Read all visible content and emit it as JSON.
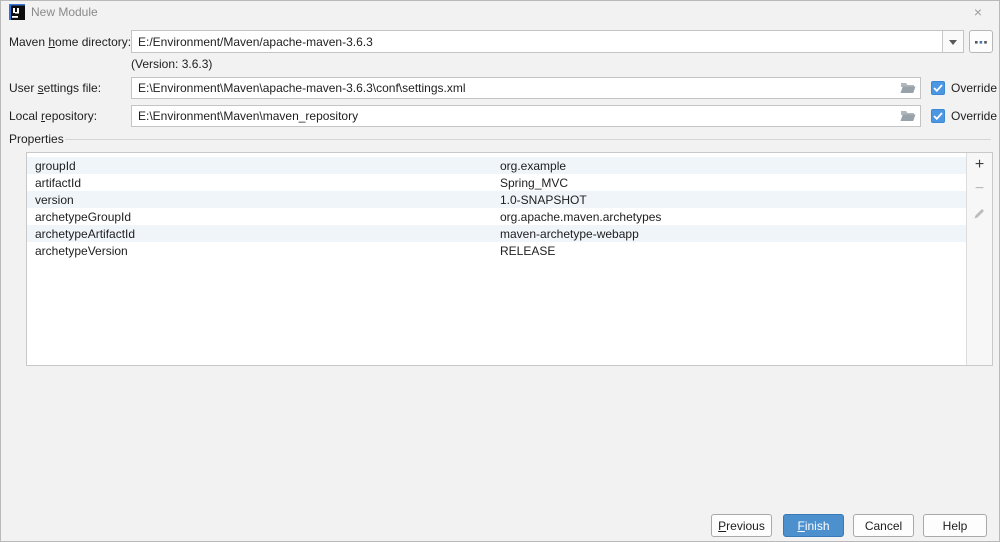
{
  "window": {
    "title": "New Module",
    "close_icon": "×"
  },
  "form": {
    "maven_home": {
      "label_pre": "Maven ",
      "label_mnemonic": "h",
      "label_post": "ome directory:",
      "value": "E:/Environment/Maven/apache-maven-3.6.3",
      "version_note": "(Version: 3.6.3)"
    },
    "user_settings": {
      "label_pre": "User ",
      "label_mnemonic": "s",
      "label_post": "ettings file:",
      "value": "E:\\Environment\\Maven\\apache-maven-3.6.3\\conf\\settings.xml",
      "override_label": "Override",
      "override_checked": true
    },
    "local_repository": {
      "label_pre": "Local ",
      "label_mnemonic": "r",
      "label_post": "epository:",
      "value": "E:\\Environment\\Maven\\maven_repository",
      "override_label": "Override",
      "override_checked": true
    }
  },
  "properties": {
    "section_label": "Properties",
    "rows": [
      {
        "name": "groupId",
        "value": "org.example"
      },
      {
        "name": "artifactId",
        "value": "Spring_MVC"
      },
      {
        "name": "version",
        "value": "1.0-SNAPSHOT"
      },
      {
        "name": "archetypeGroupId",
        "value": "org.apache.maven.archetypes"
      },
      {
        "name": "archetypeArtifactId",
        "value": "maven-archetype-webapp"
      },
      {
        "name": "archetypeVersion",
        "value": "RELEASE"
      }
    ],
    "toolbar": {
      "add_glyph": "+",
      "remove_glyph": "−"
    }
  },
  "buttons": {
    "previous_mnemonic": "P",
    "previous_rest": "revious",
    "finish_mnemonic": "F",
    "finish_rest": "inish",
    "cancel": "Cancel",
    "help": "Help"
  },
  "colors": {
    "accent_blue": "#4c90ce",
    "checkbox_blue": "#4b97e2",
    "stripe": "#f0f5fa",
    "dialog_bg": "#f2f2f2"
  }
}
